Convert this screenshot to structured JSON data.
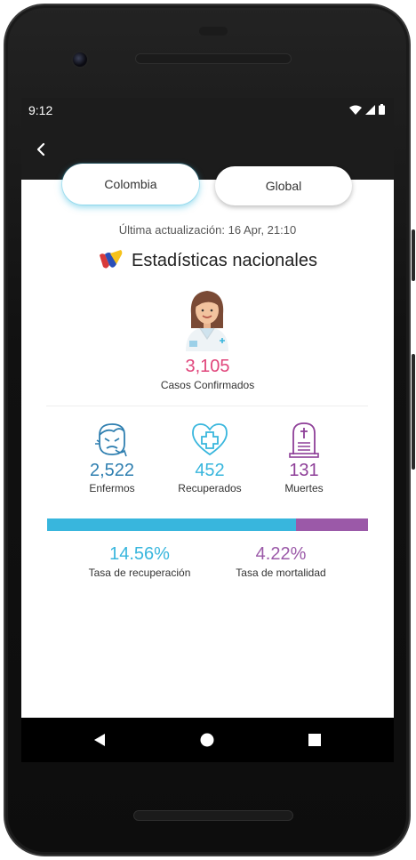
{
  "status_bar": {
    "time": "9:12"
  },
  "tabs": [
    {
      "label": "Colombia",
      "active": true
    },
    {
      "label": "Global",
      "active": false
    }
  ],
  "last_update": "Última actualización: 16 Apr, 21:10",
  "section_title": "Estadísticas nacionales",
  "confirmed": {
    "value": "3,105",
    "label": "Casos Confirmados",
    "color": "#e0457b"
  },
  "stats": {
    "sick": {
      "value": "2,522",
      "label": "Enfermos",
      "color": "#2f7fb0",
      "icon": "sick-face-icon"
    },
    "recovered": {
      "value": "452",
      "label": "Recuperados",
      "color": "#38b6dd",
      "icon": "heart-cross-icon"
    },
    "deaths": {
      "value": "131",
      "label": "Muertes",
      "color": "#8e3f98",
      "icon": "tombstone-icon"
    }
  },
  "progress": {
    "recovered_fraction": 0.776,
    "recovered_color": "#38b6dd",
    "rest_color": "#9b59a8"
  },
  "rates": {
    "recovery": {
      "value": "14.56%",
      "label": "Tasa de recuperación",
      "color": "#38b6dd"
    },
    "mortality": {
      "value": "4.22%",
      "label": "Tasa de mortalidad",
      "color": "#9b59a8"
    }
  }
}
